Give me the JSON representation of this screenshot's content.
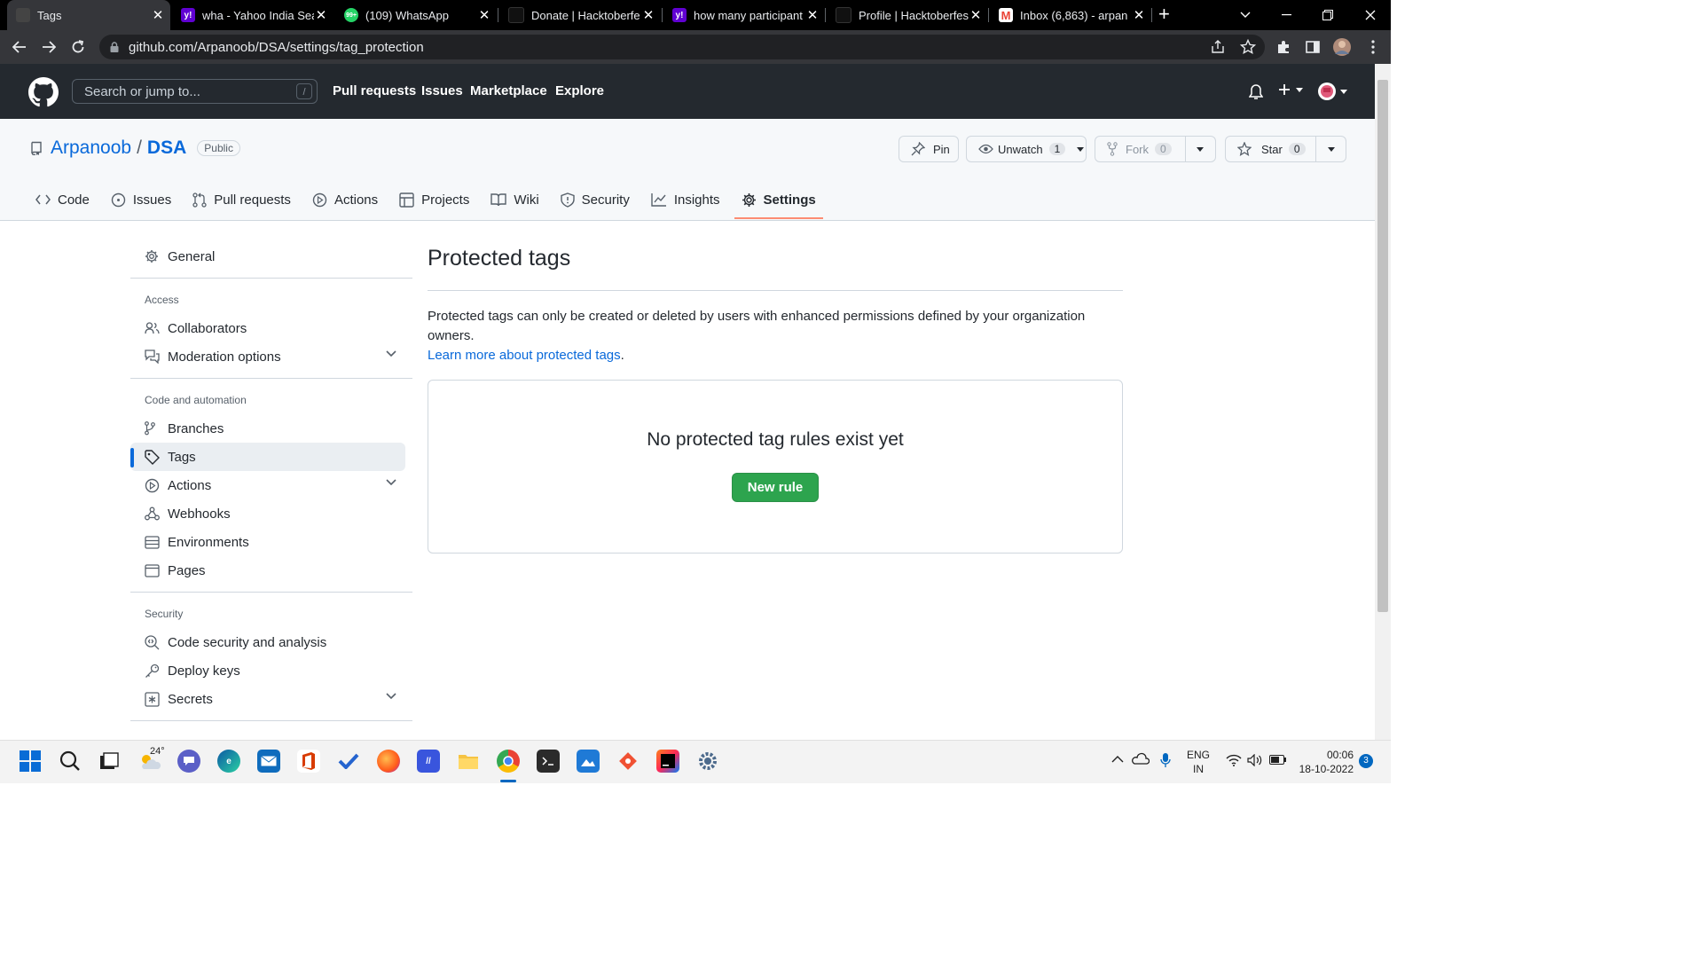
{
  "browser": {
    "tabs": [
      {
        "title": "Tags",
        "active": true
      },
      {
        "title": "wha - Yahoo India Sea"
      },
      {
        "title": "(109) WhatsApp"
      },
      {
        "title": "Donate | Hacktoberfe"
      },
      {
        "title": "how many participant"
      },
      {
        "title": "Profile | Hacktoberfes"
      },
      {
        "title": "Inbox (6,863) - arpan"
      }
    ],
    "favicon_text": {
      "yahoo": "y!",
      "whatsapp": "99+",
      "gmail": "M"
    },
    "url": "github.com/Arpanoob/DSA/settings/tag_protection"
  },
  "header": {
    "search_placeholder": "Search or jump to...",
    "search_shortcut": "/",
    "nav": [
      "Pull requests",
      "Issues",
      "Marketplace",
      "Explore"
    ]
  },
  "repo": {
    "owner": "Arpanoob",
    "separator": "/",
    "name": "DSA",
    "visibility": "Public",
    "pin_label": "Pin",
    "unwatch_label": "Unwatch",
    "watch_count": "1",
    "fork_label": "Fork",
    "fork_count": "0",
    "star_label": "Star",
    "star_count": "0",
    "tabs": [
      "Code",
      "Issues",
      "Pull requests",
      "Actions",
      "Projects",
      "Wiki",
      "Security",
      "Insights",
      "Settings"
    ]
  },
  "sidebar": {
    "general": "General",
    "access_heading": "Access",
    "collaborators": "Collaborators",
    "moderation": "Moderation options",
    "code_heading": "Code and automation",
    "branches": "Branches",
    "tags": "Tags",
    "actions": "Actions",
    "webhooks": "Webhooks",
    "environments": "Environments",
    "pages": "Pages",
    "security_heading": "Security",
    "code_security": "Code security and analysis",
    "deploy_keys": "Deploy keys",
    "secrets": "Secrets"
  },
  "main": {
    "title": "Protected tags",
    "description": "Protected tags can only be created or deleted by users with enhanced permissions defined by your organization owners.",
    "learn_more": "Learn more about protected tags",
    "learn_more_suffix": ".",
    "blankslate_title": "No protected tag rules exist yet",
    "new_rule_button": "New rule"
  },
  "taskbar": {
    "weather": "24°",
    "language": "ENG",
    "region": "IN",
    "time": "00:06",
    "date": "18-10-2022",
    "notifications": "3"
  },
  "colors": {
    "accent_blue": "#0969da",
    "green": "#2da44e",
    "selected_tab_underline": "#fd8c73"
  }
}
